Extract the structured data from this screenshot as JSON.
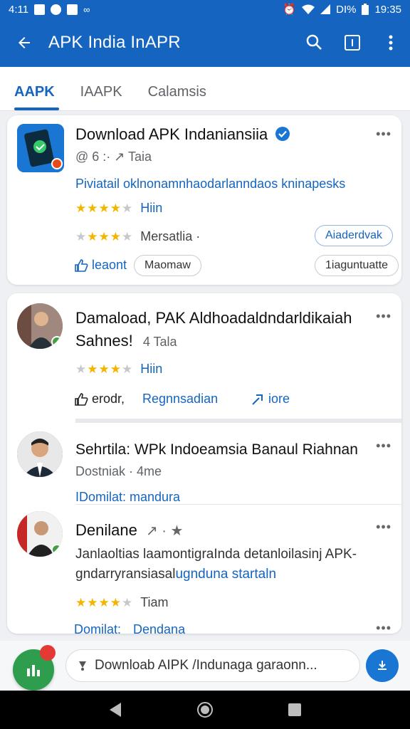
{
  "status": {
    "time_left": "4:11",
    "battery": "DI%",
    "time_right": "19:35"
  },
  "appbar": {
    "title": "APK India InAPR"
  },
  "tabs": [
    {
      "label": "AAPK"
    },
    {
      "label": "IAAPK"
    },
    {
      "label": "Calamsis"
    }
  ],
  "more": "•••",
  "card1": {
    "title": "Download APK Indaniansiia",
    "meta": "@ 6 :· ↗ Taia",
    "link": "Piviatail oklnonamnhaodarlanndaos kninapesks",
    "rating_label_1": "Hiin",
    "rating_label_2": "Mersatlia ·",
    "pill_right_1": "Aiaderdvak",
    "action_like": "leaont",
    "pill_mid": "Maomaw",
    "pill_right_2": "1iaguntuatte"
  },
  "post1": {
    "title_line1": "Damaload, PAK Aldhoadaldndarldikaiah",
    "title_line2": "Sahnes!",
    "meta": "4 Tala",
    "rating_label": "Hiin",
    "action_like": "erodr,",
    "action_reply": "Regnnsadian",
    "action_more": "iore"
  },
  "post2": {
    "title": "Sehrtila: WPk Indoeamsia Banaul Riahnan",
    "meta": "Dostniak · 4me",
    "link": "IDomilat: mandura"
  },
  "post3": {
    "title": "Denilane",
    "body_line1": "Janlaoltias laamontigraInda detanloilasinj APK-",
    "body_line2_dark": "gndarryransiasal",
    "body_line2_link": "ugnduna startaln",
    "rating_label": "Tiam",
    "link_a": "Domilat:",
    "link_b": "Dendana"
  },
  "composer": {
    "placeholder": "Downloab AIPK /Indunaga garaonn..."
  },
  "colors": {
    "primary": "#1565c0",
    "star": "#f4b400",
    "fab": "#2e9e4e"
  },
  "icons": [
    "back-arrow-icon",
    "search-icon",
    "tab-switch-icon",
    "overflow-menu-icon",
    "verified-icon",
    "thumbs-up-icon",
    "share-icon",
    "chart-icon",
    "attach-icon",
    "upload-icon",
    "nav-back-icon",
    "nav-home-icon",
    "nav-recents-icon"
  ]
}
